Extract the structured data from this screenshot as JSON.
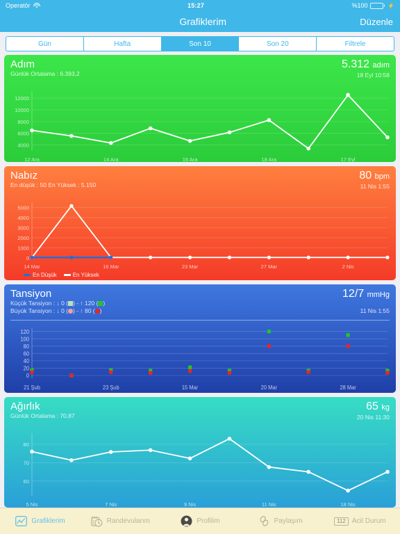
{
  "status_bar": {
    "carrier": "Operatör",
    "wifi_icon": "wifi-icon",
    "time": "15:27",
    "battery_percent": "%100",
    "battery_icon": "battery-icon",
    "charging_icon": "bolt-icon"
  },
  "navbar": {
    "title": "Grafiklerim",
    "edit_label": "Düzenle"
  },
  "segmented": {
    "options": [
      "Gün",
      "Hafta",
      "Son 10",
      "Son 20",
      "Filtrele"
    ],
    "selected": "Son 10",
    "selected_index": 2
  },
  "colors": {
    "accent": "#3fb7e8",
    "steps": "#3ce64a",
    "pulse": "#f43b28",
    "bp": "#1f3fa8",
    "weight": "#2a9fd8",
    "tabbar_bg": "#f7f1cf",
    "legend_low": "#1f6fe0",
    "legend_high": "#ffffff",
    "bp_systolic": "#23c52a",
    "bp_diastolic": "#ee2222"
  },
  "cards": [
    {
      "key": "steps",
      "title": "Adım",
      "subtitle": "Günlük Ortalama : 6.393,2",
      "value": "5.312",
      "unit": "adım",
      "date": "18 Eyl 10:58"
    },
    {
      "key": "pulse",
      "title": "Nabız",
      "subtitle": "En düşük : 50 En Yüksek : 5.150",
      "value": "80",
      "unit": "bpm",
      "date": "11 Nis 1:55",
      "legend": [
        {
          "label": "En Düşük",
          "color": "#1f6fe0"
        },
        {
          "label": "En Yüksek",
          "color": "#ffffff"
        }
      ]
    },
    {
      "key": "bp",
      "title": "Tansiyon",
      "subtitle": "Küçük Tansiyon : ↓ 0 (■) - ↑ 120 (■)",
      "subtitle_parts": {
        "small_prefix": "Küçük Tansiyon : ↓ 0 (",
        "small_mid": ") - ↑ 120 (",
        "small_suffix": ")",
        "big_prefix": "Büyük Tansiyon : ↓ 0 (",
        "big_mid": ") - ↑ 80 (",
        "big_suffix": ")"
      },
      "subtitle2": "Büyük Tansiyon : ↓ 0 (●) - ↑ 80 (●)",
      "value": "12/7",
      "unit": "mmHg",
      "date": "11 Nis 1:55"
    },
    {
      "key": "weight",
      "title": "Ağırlık",
      "subtitle": "Günlük Ortalama : 70,87",
      "value": "65",
      "unit": "kg",
      "date": "20 Nis 11:30"
    }
  ],
  "chart_data": [
    {
      "type": "line",
      "title": "Adım",
      "ylabel": "",
      "xlabel": "",
      "ylim": [
        3000,
        13200
      ],
      "yticks": [
        4000,
        6000,
        8000,
        10000,
        12000
      ],
      "x_tick_labels": [
        "12 Ara",
        "14 Ara",
        "16 Ara",
        "18 Ara",
        "17 Eyl"
      ],
      "x_tick_indices": [
        0,
        2,
        4,
        6,
        8
      ],
      "categories": [
        "12 Ara",
        "13 Ara",
        "14 Ara",
        "15 Ara",
        "16 Ara",
        "17 Ara",
        "18 Ara",
        "19 Ara",
        "17 Eyl",
        "18 Eyl"
      ],
      "values": [
        6500,
        5550,
        4350,
        6850,
        4700,
        6150,
        8250,
        3400,
        12550,
        5312
      ],
      "grid": true,
      "legend": null
    },
    {
      "type": "line",
      "title": "Nabız",
      "ylim": [
        0,
        5500
      ],
      "yticks": [
        0,
        1000,
        2000,
        3000,
        4000,
        5000
      ],
      "x_tick_labels": [
        "14 Mar",
        "16 Mar",
        "23 Mar",
        "27 Mar",
        "2 Nis"
      ],
      "x_tick_indices": [
        0,
        2,
        4,
        6,
        8
      ],
      "categories": [
        "14 Mar",
        "15 Mar",
        "16 Mar",
        "20 Mar",
        "23 Mar",
        "25 Mar",
        "27 Mar",
        "30 Mar",
        "2 Nis",
        "11 Nis"
      ],
      "series": [
        {
          "name": "En Yüksek",
          "color": "#ffffff",
          "values": [
            50,
            5150,
            50,
            50,
            50,
            50,
            50,
            50,
            50,
            50
          ]
        },
        {
          "name": "En Düşük",
          "color": "#1f6fe0",
          "values": [
            50,
            50,
            50,
            null,
            null,
            null,
            null,
            null,
            null,
            null
          ]
        }
      ],
      "grid": true,
      "legend_position": "bottom-left"
    },
    {
      "type": "scatter",
      "title": "Tansiyon",
      "ylim": [
        -8,
        130
      ],
      "yticks": [
        0,
        20,
        40,
        60,
        80,
        100,
        120
      ],
      "x_tick_labels": [
        "21 Şub",
        "23 Şub",
        "15 Mar",
        "20 Mar",
        "28 Mar"
      ],
      "x_tick_indices": [
        0,
        2,
        4,
        6,
        8
      ],
      "categories": [
        "21 Şub",
        "22 Şub",
        "23 Şub",
        "1 Mar",
        "15 Mar",
        "18 Mar",
        "20 Mar",
        "25 Mar",
        "28 Mar",
        "11 Nis"
      ],
      "series": [
        {
          "name": "Küçük Tansiyon",
          "color": "#23c52a",
          "marker": "square",
          "values": [
            14,
            0,
            14,
            13,
            22,
            13,
            120,
            13,
            110,
            13
          ]
        },
        {
          "name": "Büyük Tansiyon",
          "color": "#ee2222",
          "marker": "circle",
          "values": [
            9,
            0,
            9,
            7,
            12,
            7,
            80,
            9,
            80,
            7
          ]
        }
      ],
      "grid": true
    },
    {
      "type": "line",
      "title": "Ağırlık",
      "ylim": [
        52,
        86
      ],
      "yticks": [
        60,
        70,
        80
      ],
      "x_tick_labels": [
        "5 Nis",
        "7 Nis",
        "9 Nis",
        "11 Nis",
        "18 Nis"
      ],
      "x_tick_indices": [
        0,
        2,
        4,
        6,
        8
      ],
      "categories": [
        "5 Nis",
        "6 Nis",
        "7 Nis",
        "8 Nis",
        "9 Nis",
        "10 Nis",
        "11 Nis",
        "13 Nis",
        "18 Nis",
        "20 Nis"
      ],
      "values": [
        76,
        71.3,
        75.8,
        76.8,
        72.3,
        83,
        67.6,
        65,
        54.8,
        65
      ],
      "grid": true
    }
  ],
  "tabbar": {
    "items": [
      {
        "label": "Grafiklerim",
        "icon": "chart-icon",
        "active": true
      },
      {
        "label": "Randevularım",
        "icon": "calendar-clock-icon",
        "active": false
      },
      {
        "label": "Profilim",
        "icon": "person-icon",
        "active": false
      },
      {
        "label": "Paylaşım",
        "icon": "link-icon",
        "active": false
      },
      {
        "label": "Acil Durum",
        "icon": "emergency-112-icon",
        "active": false
      }
    ]
  }
}
